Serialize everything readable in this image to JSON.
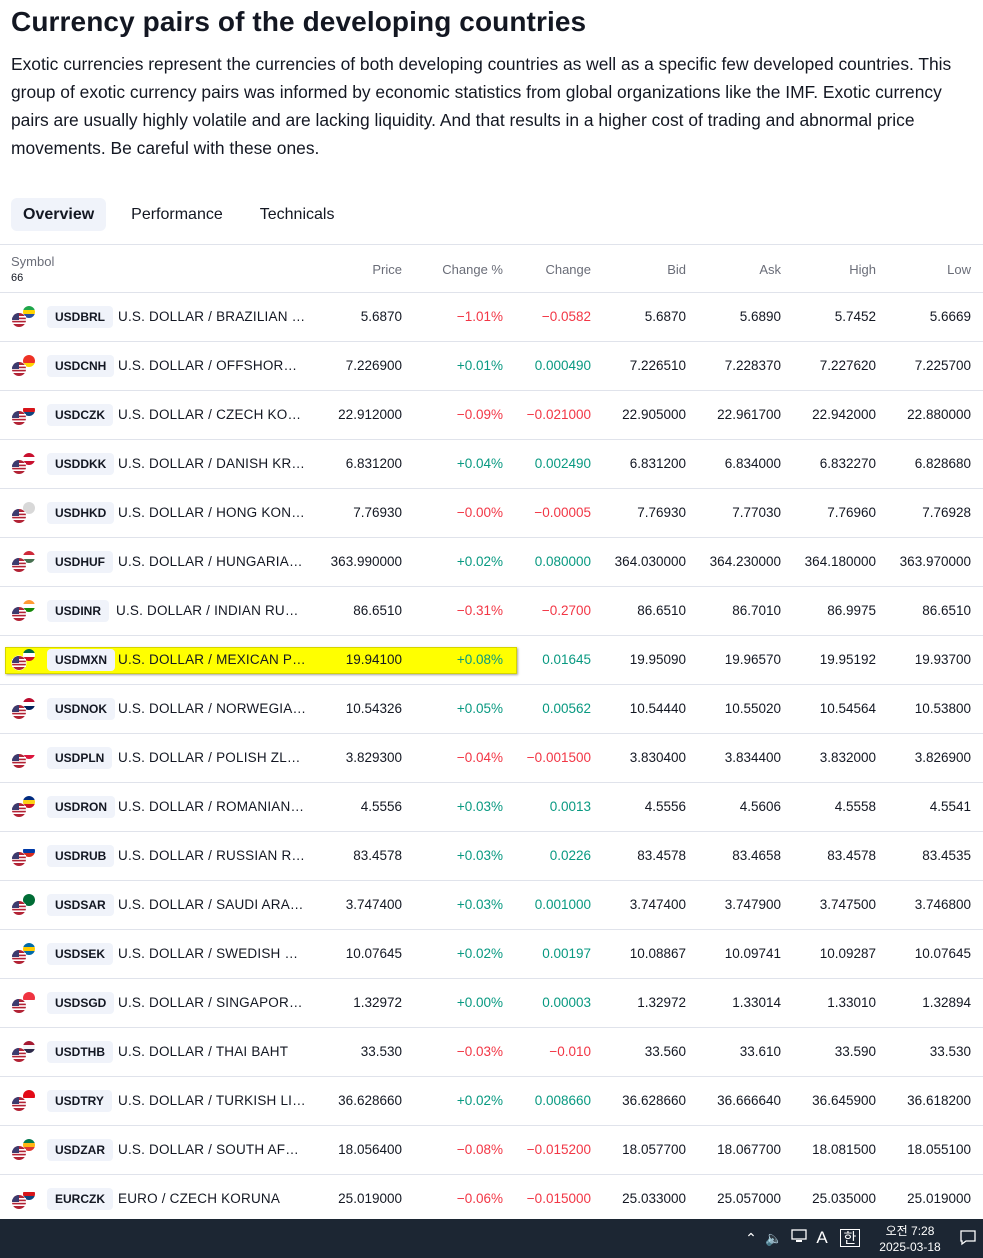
{
  "page": {
    "title": "Currency pairs of the developing countries",
    "description": "Exotic currencies represent the currencies of both developing countries as well as a specific few developed countries. This group of exotic currency pairs was informed by economic statistics from global organizations like the IMF. Exotic currency pairs are usually highly volatile and are lacking liquidity. And that results in a higher cost of trading and abnormal price movements. Be careful with these ones."
  },
  "tabs": [
    {
      "label": "Overview",
      "active": true
    },
    {
      "label": "Performance",
      "active": false
    },
    {
      "label": "Technicals",
      "active": false
    }
  ],
  "table": {
    "columns": {
      "symbol": "Symbol",
      "count": "66",
      "price": "Price",
      "change_pct": "Change %",
      "change": "Change",
      "bid": "Bid",
      "ask": "Ask",
      "high": "High",
      "low": "Low"
    },
    "colors": {
      "positive": "#089981",
      "negative": "#f23645",
      "highlight": "#ffff00"
    },
    "rows": [
      {
        "ticker": "USDBRL",
        "name": "U.S. DOLLAR / BRAZILIAN R...",
        "price": "5.6870",
        "chg_pct": "−1.01%",
        "chg": "−0.0582",
        "bid": "5.6870",
        "ask": "5.6890",
        "high": "5.7452",
        "low": "5.6669",
        "dir": "neg",
        "flag": [
          "#1fa64a",
          "#ffd400",
          "#2a4fa0"
        ],
        "highlighted": false
      },
      {
        "ticker": "USDCNH",
        "name": "U.S. DOLLAR / OFFSHORE C...",
        "price": "7.226900",
        "chg_pct": "+0.01%",
        "chg": "0.000490",
        "bid": "7.226510",
        "ask": "7.228370",
        "high": "7.227620",
        "low": "7.225700",
        "dir": "pos",
        "flag": [
          "#ee3124",
          "#ee3124",
          "#ffd400"
        ],
        "highlighted": false
      },
      {
        "ticker": "USDCZK",
        "name": "U.S. DOLLAR / CZECH KORU...",
        "price": "22.912000",
        "chg_pct": "−0.09%",
        "chg": "−0.021000",
        "bid": "22.905000",
        "ask": "22.961700",
        "high": "22.942000",
        "low": "22.880000",
        "dir": "neg",
        "flag": [
          "#ffffff",
          "#d7141a",
          "#11457e"
        ],
        "highlighted": false
      },
      {
        "ticker": "USDDKK",
        "name": "U.S. DOLLAR / DANISH KRONE",
        "price": "6.831200",
        "chg_pct": "+0.04%",
        "chg": "0.002490",
        "bid": "6.831200",
        "ask": "6.834000",
        "high": "6.832270",
        "low": "6.828680",
        "dir": "pos",
        "flag": [
          "#c8102e",
          "#ffffff",
          "#c8102e"
        ],
        "highlighted": false
      },
      {
        "ticker": "USDHKD",
        "name": "U.S. DOLLAR / HONG KONG ...",
        "price": "7.76930",
        "chg_pct": "−0.00%",
        "chg": "−0.00005",
        "bid": "7.76930",
        "ask": "7.77030",
        "high": "7.76960",
        "low": "7.76928",
        "dir": "neg",
        "flag": [
          "#d8d8d8",
          "#d8d8d8",
          "#d8d8d8"
        ],
        "highlighted": false
      },
      {
        "ticker": "USDHUF",
        "name": "U.S. DOLLAR / HUNGARIAN ...",
        "price": "363.990000",
        "chg_pct": "+0.02%",
        "chg": "0.080000",
        "bid": "364.030000",
        "ask": "364.230000",
        "high": "364.180000",
        "low": "363.970000",
        "dir": "pos",
        "flag": [
          "#ce2939",
          "#ffffff",
          "#477050"
        ],
        "highlighted": false
      },
      {
        "ticker": "USDINR",
        "name": "U.S. DOLLAR / INDIAN RUPEE",
        "price": "86.6510",
        "chg_pct": "−0.31%",
        "chg": "−0.2700",
        "bid": "86.6510",
        "ask": "86.7010",
        "high": "86.9975",
        "low": "86.6510",
        "dir": "neg",
        "flag": [
          "#ff9933",
          "#ffffff",
          "#138808"
        ],
        "highlighted": false
      },
      {
        "ticker": "USDMXN",
        "name": "U.S. DOLLAR / MEXICAN PESO",
        "price": "19.94100",
        "chg_pct": "+0.08%",
        "chg": "0.01645",
        "bid": "19.95090",
        "ask": "19.96570",
        "high": "19.95192",
        "low": "19.93700",
        "dir": "pos",
        "flag": [
          "#006847",
          "#ffffff",
          "#ce1126"
        ],
        "highlighted": true
      },
      {
        "ticker": "USDNOK",
        "name": "U.S. DOLLAR / NORWEGIAN ...",
        "price": "10.54326",
        "chg_pct": "+0.05%",
        "chg": "0.00562",
        "bid": "10.54440",
        "ask": "10.55020",
        "high": "10.54564",
        "low": "10.53800",
        "dir": "pos",
        "flag": [
          "#ba0c2f",
          "#ffffff",
          "#00205b"
        ],
        "highlighted": false
      },
      {
        "ticker": "USDPLN",
        "name": "U.S. DOLLAR / POLISH ZLOTY",
        "price": "3.829300",
        "chg_pct": "−0.04%",
        "chg": "−0.001500",
        "bid": "3.830400",
        "ask": "3.834400",
        "high": "3.832000",
        "low": "3.826900",
        "dir": "neg",
        "flag": [
          "#ffffff",
          "#ffffff",
          "#dc143c"
        ],
        "highlighted": false
      },
      {
        "ticker": "USDRON",
        "name": "U.S. DOLLAR / ROMANIAN L...",
        "price": "4.5556",
        "chg_pct": "+0.03%",
        "chg": "0.0013",
        "bid": "4.5556",
        "ask": "4.5606",
        "high": "4.5558",
        "low": "4.5541",
        "dir": "pos",
        "flag": [
          "#002b7f",
          "#fcd116",
          "#ce1126"
        ],
        "highlighted": false
      },
      {
        "ticker": "USDRUB",
        "name": "U.S. DOLLAR / RUSSIAN RUB...",
        "price": "83.4578",
        "chg_pct": "+0.03%",
        "chg": "0.0226",
        "bid": "83.4578",
        "ask": "83.4658",
        "high": "83.4578",
        "low": "83.4535",
        "dir": "pos",
        "flag": [
          "#ffffff",
          "#0039a6",
          "#d52b1e"
        ],
        "highlighted": false
      },
      {
        "ticker": "USDSAR",
        "name": "U.S. DOLLAR / SAUDI ARABI...",
        "price": "3.747400",
        "chg_pct": "+0.03%",
        "chg": "0.001000",
        "bid": "3.747400",
        "ask": "3.747900",
        "high": "3.747500",
        "low": "3.746800",
        "dir": "pos",
        "flag": [
          "#006c35",
          "#006c35",
          "#006c35"
        ],
        "highlighted": false
      },
      {
        "ticker": "USDSEK",
        "name": "U.S. DOLLAR / SWEDISH KRO...",
        "price": "10.07645",
        "chg_pct": "+0.02%",
        "chg": "0.00197",
        "bid": "10.08867",
        "ask": "10.09741",
        "high": "10.09287",
        "low": "10.07645",
        "dir": "pos",
        "flag": [
          "#006aa7",
          "#fecc00",
          "#006aa7"
        ],
        "highlighted": false
      },
      {
        "ticker": "USDSGD",
        "name": "U.S. DOLLAR / SINGAPORE D...",
        "price": "1.32972",
        "chg_pct": "+0.00%",
        "chg": "0.00003",
        "bid": "1.32972",
        "ask": "1.33014",
        "high": "1.33010",
        "low": "1.32894",
        "dir": "pos",
        "flag": [
          "#ef3340",
          "#ef3340",
          "#ffffff"
        ],
        "highlighted": false
      },
      {
        "ticker": "USDTHB",
        "name": "U.S. DOLLAR / THAI BAHT",
        "price": "33.530",
        "chg_pct": "−0.03%",
        "chg": "−0.010",
        "bid": "33.560",
        "ask": "33.610",
        "high": "33.590",
        "low": "33.530",
        "dir": "neg",
        "flag": [
          "#a51931",
          "#f4f5f8",
          "#2d2a4a"
        ],
        "highlighted": false
      },
      {
        "ticker": "USDTRY",
        "name": "U.S. DOLLAR / TURKISH LIRA",
        "price": "36.628660",
        "chg_pct": "+0.02%",
        "chg": "0.008660",
        "bid": "36.628660",
        "ask": "36.666640",
        "high": "36.645900",
        "low": "36.618200",
        "dir": "pos",
        "flag": [
          "#e30a17",
          "#e30a17",
          "#ffffff"
        ],
        "highlighted": false
      },
      {
        "ticker": "USDZAR",
        "name": "U.S. DOLLAR / SOUTH AFRIC...",
        "price": "18.056400",
        "chg_pct": "−0.08%",
        "chg": "−0.015200",
        "bid": "18.057700",
        "ask": "18.067700",
        "high": "18.081500",
        "low": "18.055100",
        "dir": "neg",
        "flag": [
          "#007a4d",
          "#ffb612",
          "#de3831"
        ],
        "highlighted": false
      },
      {
        "ticker": "EURCZK",
        "name": "EURO / CZECH KORUNA",
        "price": "25.019000",
        "chg_pct": "−0.06%",
        "chg": "−0.015000",
        "bid": "25.033000",
        "ask": "25.057000",
        "high": "25.035000",
        "low": "25.019000",
        "dir": "neg",
        "flag": [
          "#ffffff",
          "#d7141a",
          "#11457e"
        ],
        "highlighted": false
      }
    ]
  },
  "taskbar": {
    "ime_mode": "A",
    "ime_lang": "한",
    "time": "오전 7:28",
    "date": "2025-03-18"
  }
}
